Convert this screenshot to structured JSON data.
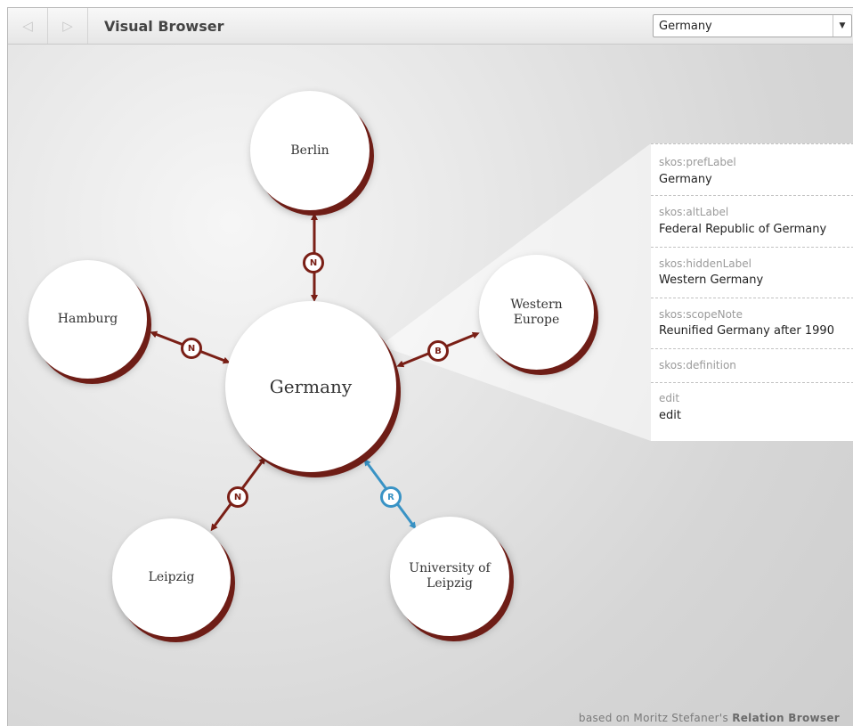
{
  "toolbar": {
    "back_icon": "back-arrow-icon",
    "forward_icon": "forward-arrow-icon",
    "back_glyph": "◁",
    "forward_glyph": "▷",
    "title": "Visual Browser",
    "select_value": "Germany",
    "select_arrow": "▼"
  },
  "graph": {
    "center": {
      "label": "Germany"
    },
    "nodes": [
      {
        "id": "berlin",
        "label": "Berlin",
        "relation": "N"
      },
      {
        "id": "hamburg",
        "label": "Hamburg",
        "relation": "N"
      },
      {
        "id": "western-europe",
        "label": "Western Europe",
        "relation": "B"
      },
      {
        "id": "leipzig",
        "label": "Leipzig",
        "relation": "N"
      },
      {
        "id": "university-of-leipzig",
        "label": "University of Leipzig",
        "relation": "R"
      }
    ]
  },
  "details": {
    "rows": [
      {
        "key": "skos:prefLabel",
        "value": "Germany"
      },
      {
        "key": "skos:altLabel",
        "value": "Federal Republic of Germany"
      },
      {
        "key": "skos:hiddenLabel",
        "value": "Western Germany"
      },
      {
        "key": "skos:scopeNote",
        "value": "Reunified Germany after 1990"
      },
      {
        "key": "skos:definition",
        "value": ""
      },
      {
        "key": "edit",
        "value": "edit"
      }
    ]
  },
  "footer": {
    "credit_prefix": "based on Moritz Stefaner's",
    "credit_bold": "Relation Browser"
  },
  "colors": {
    "relation": "#7a1f16",
    "related": "#3993c5",
    "canvas": "#d6d6d6"
  }
}
